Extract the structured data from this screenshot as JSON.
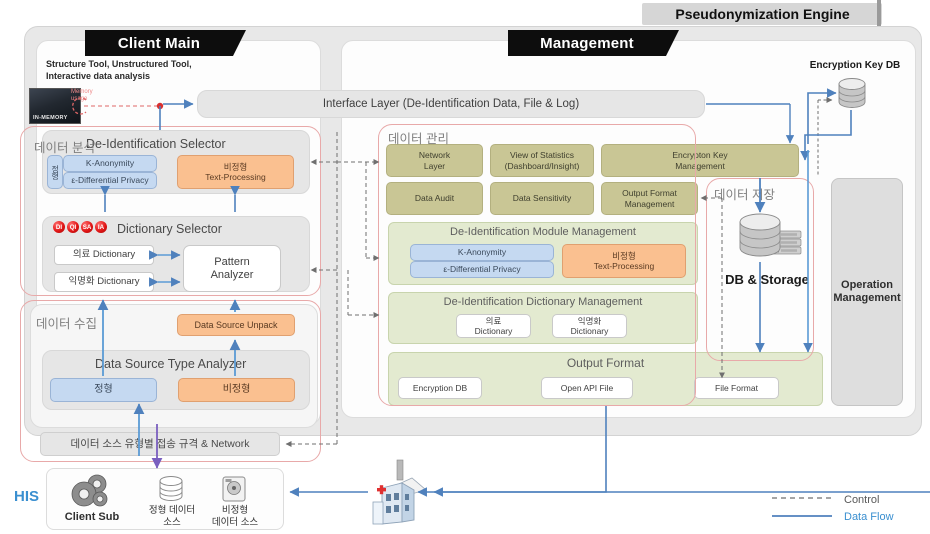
{
  "diagram": {
    "engine_title": "Pseudonymization Engine",
    "client_main_title": "Client Main",
    "management_title": "Management"
  },
  "client": {
    "subtitle_line1": "Structure Tool, Unstructured Tool,",
    "subtitle_line2": "Interactive data analysis",
    "inmemory_label": "IN-MEMORY",
    "memory_note_l1": "Memory",
    "memory_note_l2": "usage",
    "analysis_group": "데이터 분석",
    "selector_title": "De-Identification Selector",
    "vertical_label": "정형",
    "k_anonymity": "K-Anonymity",
    "differential_privacy": "ε-Differential Privacy",
    "unstructured_l1": "비정형",
    "unstructured_l2": "Text-Processing",
    "dictionary_selector_title": "Dictionary Selector",
    "badges": [
      "DI",
      "QI",
      "SA",
      "IA"
    ],
    "medical_dictionary": "의료 Dictionary",
    "anon_dictionary": "익명화 Dictionary",
    "pattern_analyzer_l1": "Pattern",
    "pattern_analyzer_l2": "Analyzer",
    "collect_group": "데이터 수집",
    "data_source_unpack": "Data Source Unpack",
    "data_source_type_analyzer": "Data Source Type Analyzer",
    "structured": "정형",
    "unstructured": "비정형",
    "network_spec": "데이터 소스 유형별 접송 규격 & Network"
  },
  "interface": {
    "label": "Interface Layer (De-Identification Data, File & Log)"
  },
  "management": {
    "data_mgmt_group": "데이터 관리",
    "tiles": [
      {
        "label": "Network\nLayer"
      },
      {
        "label": "View of Statistics\n(Dashboard/Insight)"
      },
      {
        "label": "Encrypton Key\nManagement"
      },
      {
        "label": "Data Audit"
      },
      {
        "label": "Data Sensitivity"
      },
      {
        "label": "Output Format\nManagement"
      }
    ],
    "tile_network_l1": "Network",
    "tile_network_l2": "Layer",
    "tile_stats_l1": "View of Statistics",
    "tile_stats_l2": "(Dashboard/Insight)",
    "tile_enckey_l1": "Encrypton Key",
    "tile_enckey_l2": "Management",
    "tile_audit": "Data Audit",
    "tile_sensitivity": "Data Sensitivity",
    "tile_outfmt_l1": "Output Format",
    "tile_outfmt_l2": "Management",
    "module_mgmt_title": "De-Identification Module Management",
    "module_k_anonymity": "K-Anonymity",
    "module_differential_privacy": "ε-Differential Privacy",
    "module_unstructured_l1": "비정형",
    "module_unstructured_l2": "Text-Processing",
    "dict_mgmt_title": "De-Identification Dictionary Management",
    "dict_medical_l1": "의료",
    "dict_medical_l2": "Dictionary",
    "dict_anon_l1": "익명화",
    "dict_anon_l2": "Dictionary",
    "output_format_title": "Output Format",
    "output_encryption_db": "Encryption DB",
    "output_open_api_file": "Open API File",
    "output_file_format": "File Format"
  },
  "storage": {
    "encryption_key_db": "Encryption Key DB",
    "group_label": "데이터 저장",
    "db_storage": "DB & Storage",
    "operation_management_l1": "Operation",
    "operation_management_l2": "Management"
  },
  "bottom": {
    "his": "HIS",
    "client_sub": "Client Sub",
    "structured_source_l1": "정형 데이터",
    "structured_source_l2": "소스",
    "unstructured_source_l1": "비정형",
    "unstructured_source_l2": "데이터 소스"
  },
  "legend": {
    "control": "Control",
    "data_flow": "Data Flow"
  },
  "colors": {
    "accent_blue": "#4f81bd",
    "control_dash": "#808080",
    "khaki": "#c9c695",
    "green_panel": "#e3ead0",
    "blue_box": "#c5d9f1",
    "orange_box": "#fac090",
    "rose_outline": "#e8a9a9",
    "his_blue": "#3a8fd0"
  }
}
